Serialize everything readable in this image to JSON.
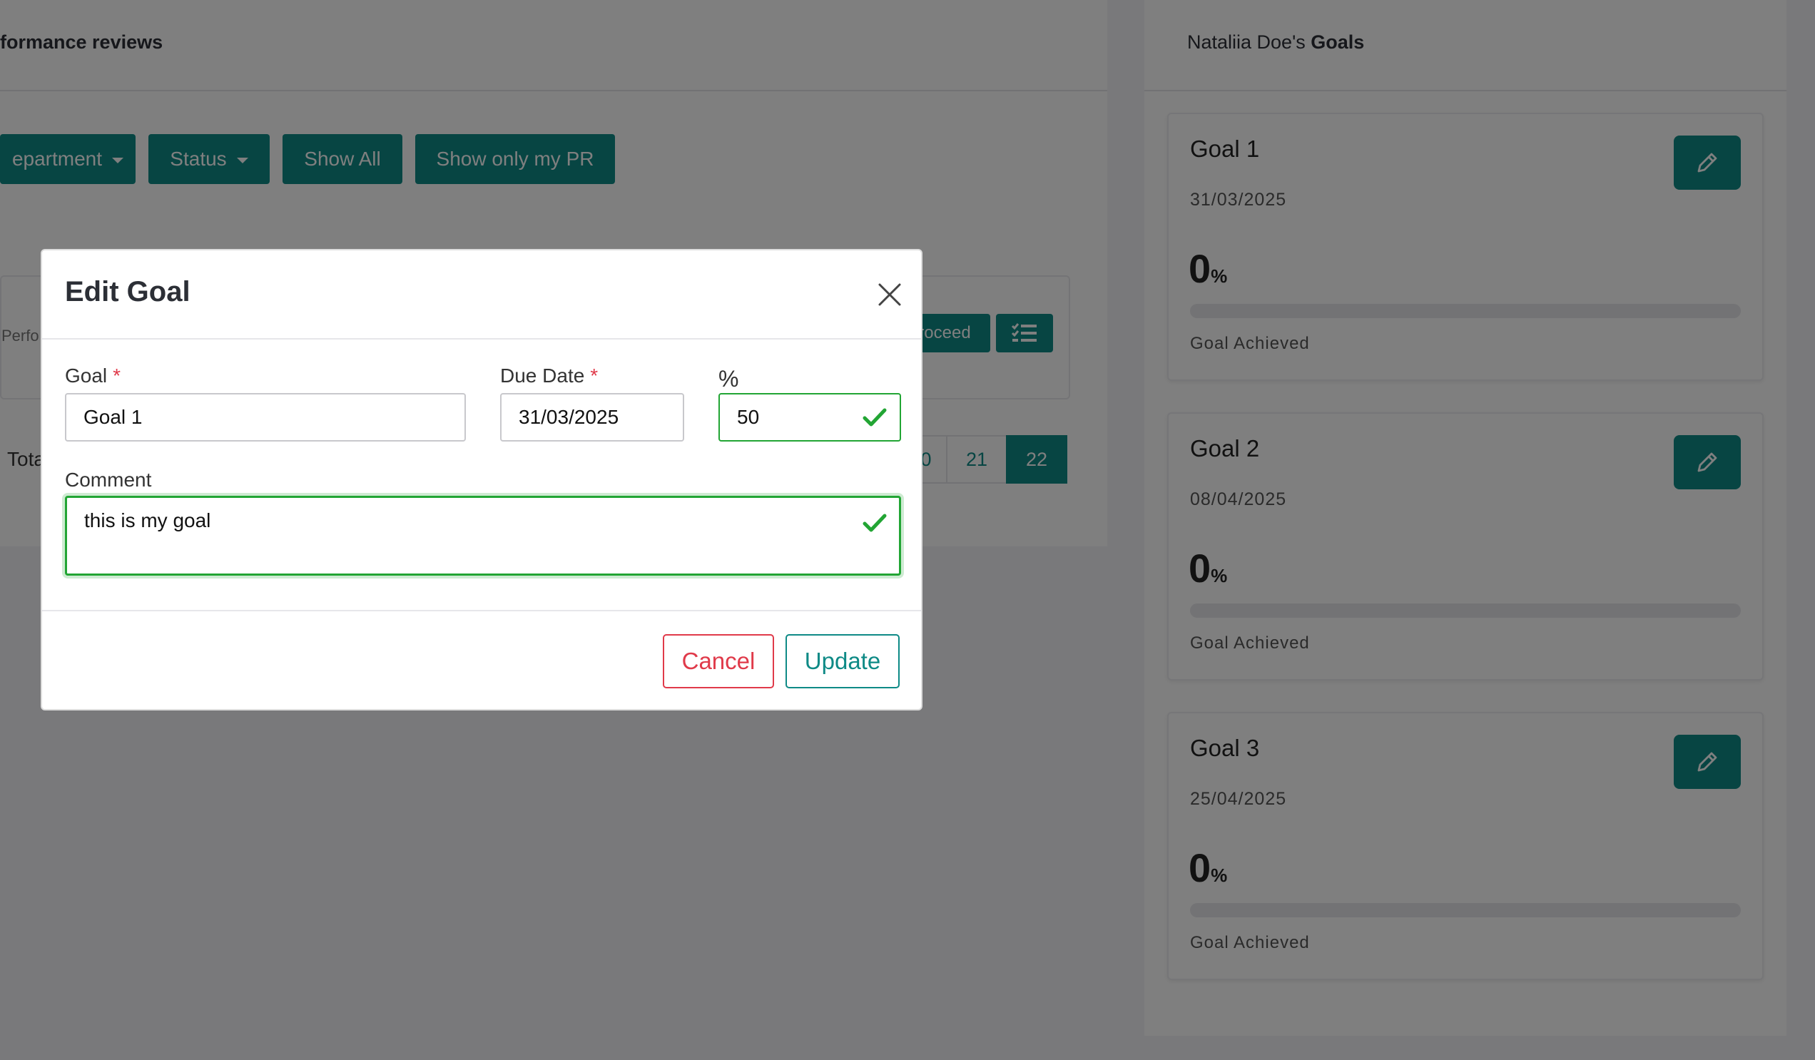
{
  "left_panel": {
    "title": "formance reviews",
    "toolbar": {
      "department_label": "epartment",
      "status_label": "Status",
      "show_all_label": "Show All",
      "show_only_my_pr_label": "Show only my PR"
    },
    "card": {
      "snippet": "Perfo",
      "proceed_label": "roceed",
      "total_label": "Tota"
    },
    "pagination": [
      "0",
      "21",
      "22"
    ],
    "active_page": "22"
  },
  "right_panel": {
    "title_name": "Nataliia Doe's",
    "title_bold": "Goals",
    "goals": [
      {
        "title": "Goal 1",
        "date": "31/03/2025",
        "percent": "0",
        "unit": "%",
        "achieved_label": "Goal Achieved",
        "progress": 0
      },
      {
        "title": "Goal 2",
        "date": "08/04/2025",
        "percent": "0",
        "unit": "%",
        "achieved_label": "Goal Achieved",
        "progress": 0
      },
      {
        "title": "Goal 3",
        "date": "25/04/2025",
        "percent": "0",
        "unit": "%",
        "achieved_label": "Goal Achieved",
        "progress": 0
      }
    ]
  },
  "modal": {
    "title": "Edit Goal",
    "goal_label": "Goal",
    "goal_value": "Goal 1",
    "due_date_label": "Due Date",
    "due_date_value": "31/03/2025",
    "percent_label": "%",
    "percent_value": "50",
    "comment_label": "Comment",
    "comment_value": "this is my goal",
    "required_mark": "*",
    "cancel_label": "Cancel",
    "update_label": "Update"
  },
  "colors": {
    "accent": "#0e8a86",
    "danger": "#e03a4a",
    "valid": "#22a534"
  },
  "icons": [
    "close-icon",
    "pencil-icon",
    "checkmark-icon",
    "list-check-icon",
    "caret-down-icon"
  ]
}
